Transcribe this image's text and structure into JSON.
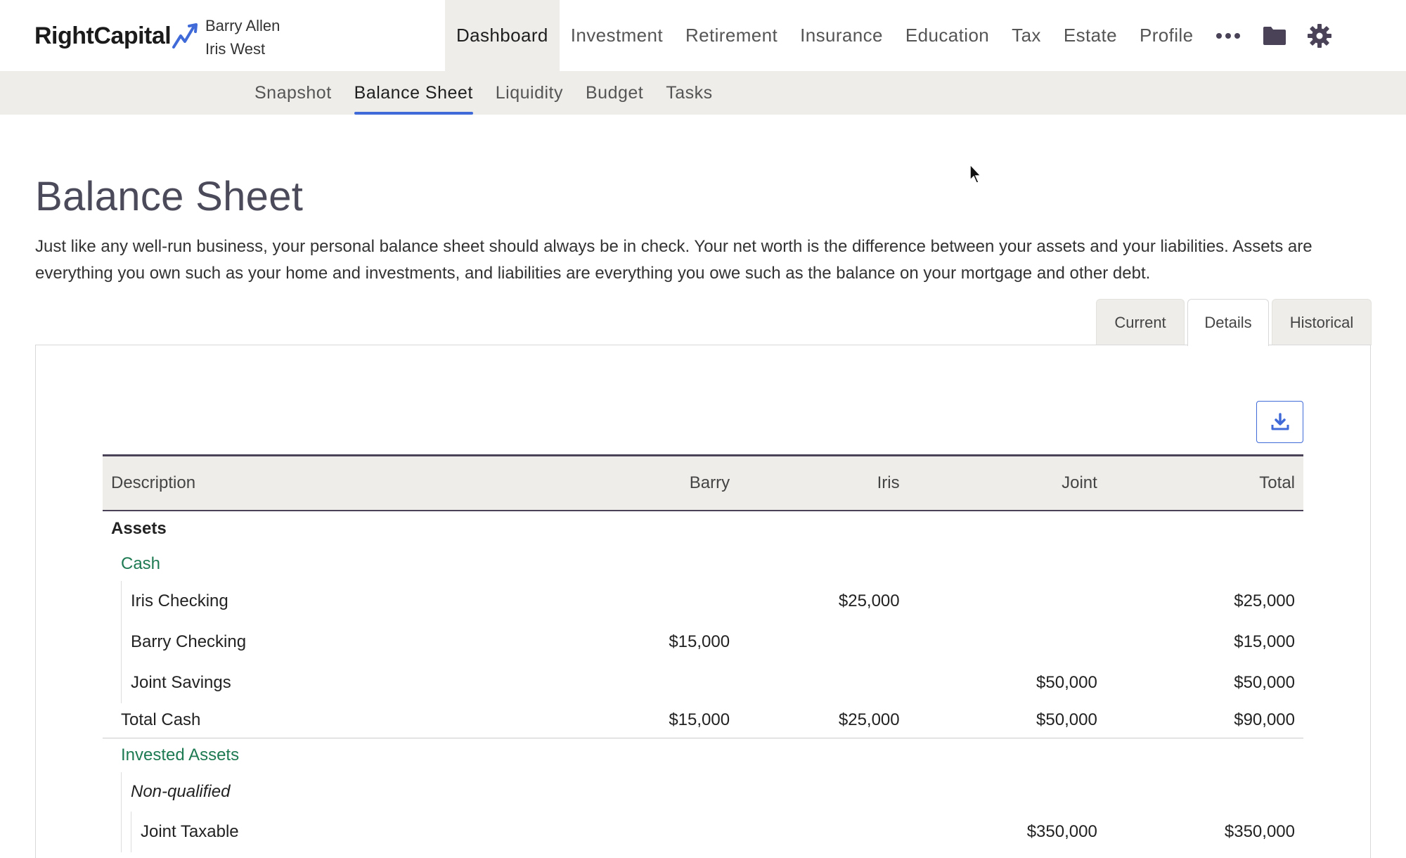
{
  "app": {
    "logo_text": "RightCapital",
    "clients": [
      "Barry Allen",
      "Iris West"
    ]
  },
  "main_nav": {
    "items": [
      "Dashboard",
      "Investment",
      "Retirement",
      "Insurance",
      "Education",
      "Tax",
      "Estate",
      "Profile"
    ],
    "active": "Dashboard",
    "more_icon": "more-dots-icon",
    "folder_icon": "folder-icon",
    "settings_icon": "gear-icon"
  },
  "sub_nav": {
    "items": [
      "Snapshot",
      "Balance Sheet",
      "Liquidity",
      "Budget",
      "Tasks"
    ],
    "active": "Balance Sheet"
  },
  "page": {
    "title": "Balance Sheet",
    "description": "Just like any well-run business, your personal balance sheet should always be in check. Your net worth is the difference between your assets and your liabilities. Assets are everything you own such as your home and investments, and liabilities are everything you owe such as the balance on your mortgage and other debt."
  },
  "view_tabs": {
    "items": [
      "Current",
      "Details",
      "Historical"
    ],
    "active": "Details"
  },
  "download_icon": "download-icon",
  "table": {
    "headers": [
      "Description",
      "Barry",
      "Iris",
      "Joint",
      "Total"
    ],
    "section_assets": "Assets",
    "cash": {
      "label": "Cash",
      "rows": [
        {
          "label": "Iris Checking",
          "barry": "",
          "iris": "$25,000",
          "joint": "",
          "total": "$25,000"
        },
        {
          "label": "Barry Checking",
          "barry": "$15,000",
          "iris": "",
          "joint": "",
          "total": "$15,000"
        },
        {
          "label": "Joint Savings",
          "barry": "",
          "iris": "",
          "joint": "$50,000",
          "total": "$50,000"
        }
      ],
      "total": {
        "label": "Total Cash",
        "barry": "$15,000",
        "iris": "$25,000",
        "joint": "$50,000",
        "total": "$90,000"
      }
    },
    "invested": {
      "label": "Invested Assets",
      "subgroup": "Non-qualified",
      "rows": [
        {
          "label": "Joint Taxable",
          "barry": "",
          "iris": "",
          "joint": "$350,000",
          "total": "$350,000"
        }
      ]
    }
  },
  "colors": {
    "accent": "#3f6ad8",
    "group_label": "#1e7a52",
    "nav_bg": "#eeede9",
    "header_border": "#4a4358"
  }
}
